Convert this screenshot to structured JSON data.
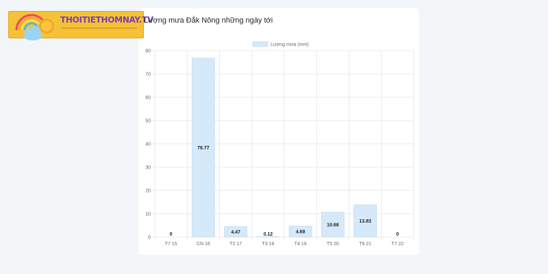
{
  "logo": {
    "text": "THOITIETHOMNAY.TV",
    "tagline": ""
  },
  "colors": {
    "bar_fill": "#d6e9fa",
    "bar_stroke": "#b7d6f3",
    "grid": "#e9e9e9",
    "page_bg": "#f2f6f8"
  },
  "chart_data": {
    "type": "bar",
    "title": "Lượng mưa Đắk Nông những ngày tới",
    "categories": [
      "T7 15",
      "CN 16",
      "T2 17",
      "T3 18",
      "T4 19",
      "T5 20",
      "T6 21",
      "T7 22"
    ],
    "series": [
      {
        "name": "Lượng mưa (mm)",
        "values": [
          0,
          76.77,
          4.47,
          0.12,
          4.69,
          10.68,
          13.83,
          0
        ]
      }
    ],
    "data_labels": [
      "0",
      "76.77",
      "4.47",
      "0.12",
      "4.69",
      "10.68",
      "13.83",
      "0"
    ],
    "ylim": [
      0,
      80
    ],
    "yticks": [
      0,
      10,
      20,
      30,
      40,
      50,
      60,
      70,
      80
    ],
    "grid": true,
    "legend_position": "top-center"
  }
}
